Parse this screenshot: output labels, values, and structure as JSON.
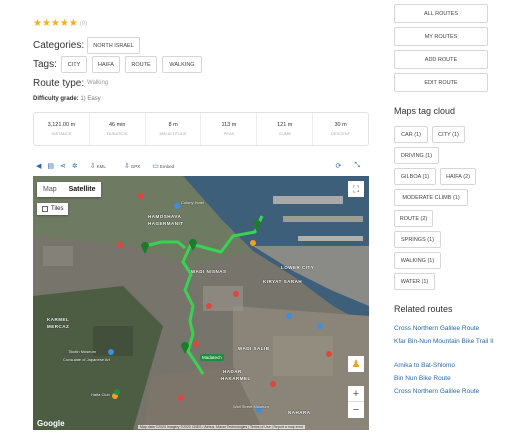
{
  "rating": {
    "stars": "★★★★★",
    "count": "(0)"
  },
  "categories": {
    "label": "Categories:",
    "items": [
      "NORTH ISRAEL"
    ]
  },
  "tags": {
    "label": "Tags:",
    "items": [
      "CITY",
      "HAIFA",
      "ROUTE",
      "WALKING"
    ]
  },
  "route_type": {
    "label": "Route type:",
    "value": "Walking"
  },
  "difficulty": {
    "label": "Difficulty grade:",
    "value": "1) Easy"
  },
  "stats": [
    {
      "value": "3,121.00 m",
      "label": "Distance"
    },
    {
      "value": "46 min",
      "label": "Duration"
    },
    {
      "value": "8 m",
      "label": "Min altitude"
    },
    {
      "value": "113 m",
      "label": "Peak"
    },
    {
      "value": "121 m",
      "label": "Climb"
    },
    {
      "value": "30 m",
      "label": "Descent"
    }
  ],
  "map_toolbar": {
    "kml": "KML",
    "gpx": "GPX",
    "embed": "Embed"
  },
  "map": {
    "type_map": "Map",
    "type_satellite": "Satellite",
    "tiles_label": "Tiles",
    "google": "Google",
    "attribution": "Map data ©2020 Imagery ©2020 CNES / Airbus, Maxar Technologies | Terms of Use | Report a map error",
    "badge": "Madatech",
    "labels": {
      "hamoshava": "HAMOSHAVA",
      "hagermanit": "HAGERMANIT",
      "wadi_nisnas": "WADI NISNAS",
      "lower_city": "LOWER CITY",
      "kiryat_sarah": "KIRYAT SARAH",
      "hadar": "HADAR",
      "hakarmel": "HAKARMEL",
      "karmel": "KARMEL",
      "mercaz": "MERCAZ",
      "wadi_salib": "WADI SALIB",
      "hadar2": "HADAR",
      "hakarmel2": "HAKARMEL",
      "nahara": "NAHARA",
      "colony": "Colony Hotel",
      "museum": "Tikotin Museum",
      "consulate": "Consulate of Japanese Art",
      "wall": "Wall Street Museum",
      "club": "Haifa Club"
    }
  },
  "sidebar": {
    "buttons": [
      "ALL ROUTES",
      "MY ROUTES",
      "ADD ROUTE",
      "EDIT ROUTE"
    ],
    "cloud_title": "Maps tag cloud",
    "cloud": [
      "CAR (1)",
      "CITY (1)",
      "DRIVING (1)",
      "GILBOA (1)",
      "HAIFA (2)",
      "MODERATE CLIMB (1)",
      "ROUTE (2)",
      "SPRINGS (1)",
      "WALKING (1)",
      "WATER (1)"
    ],
    "related_title": "Related routes",
    "related": [
      "Cross Northern Galilee Route",
      "Kfar Bin-Nun Mountain Bike Trail II",
      "Amika to Bat-Shlomo",
      "Bin Nun Bike Route",
      "Cross Northern Galilee Route"
    ]
  },
  "colors": {
    "route": "#39d353",
    "link": "#2a6aa8",
    "star": "#f2b01e"
  }
}
